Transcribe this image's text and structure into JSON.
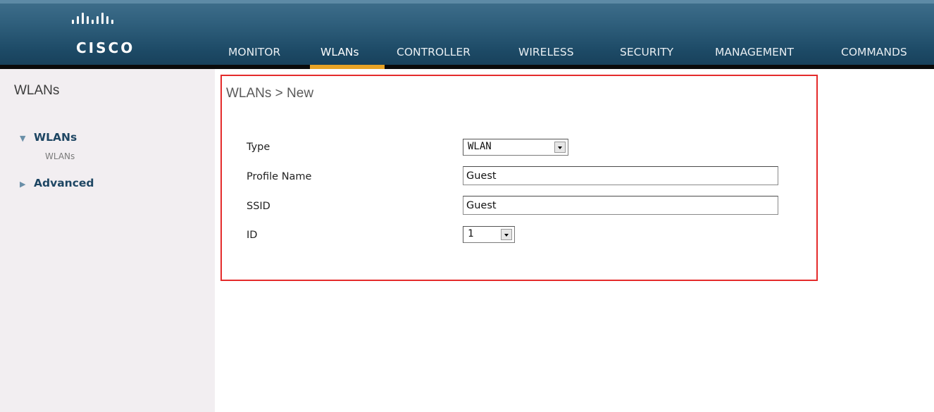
{
  "brand": {
    "name": "CISCO"
  },
  "nav": {
    "items": [
      {
        "label": "MONITOR",
        "active": false
      },
      {
        "label": "WLANs",
        "active": true
      },
      {
        "label": "CONTROLLER",
        "active": false
      },
      {
        "label": "WIRELESS",
        "active": false
      },
      {
        "label": "SECURITY",
        "active": false
      },
      {
        "label": "MANAGEMENT",
        "active": false
      },
      {
        "label": "COMMANDS",
        "active": false
      }
    ]
  },
  "sidebar": {
    "title": "WLANs",
    "groups": [
      {
        "label": "WLANs",
        "expanded": true,
        "children": [
          {
            "label": "WLANs"
          }
        ]
      },
      {
        "label": "Advanced",
        "expanded": false,
        "children": []
      }
    ]
  },
  "page": {
    "title": "WLANs > New",
    "fields": [
      {
        "label": "Type",
        "kind": "select",
        "value": "WLAN"
      },
      {
        "label": "Profile Name",
        "kind": "text",
        "value": "Guest"
      },
      {
        "label": "SSID",
        "kind": "text",
        "value": "Guest"
      },
      {
        "label": "ID",
        "kind": "select",
        "value": "1"
      }
    ]
  },
  "colors": {
    "header": "#2f5f7c",
    "active_tab": "#e8a325",
    "highlight_border": "#e42b2b",
    "sidebar_bg": "#f2eef1"
  }
}
